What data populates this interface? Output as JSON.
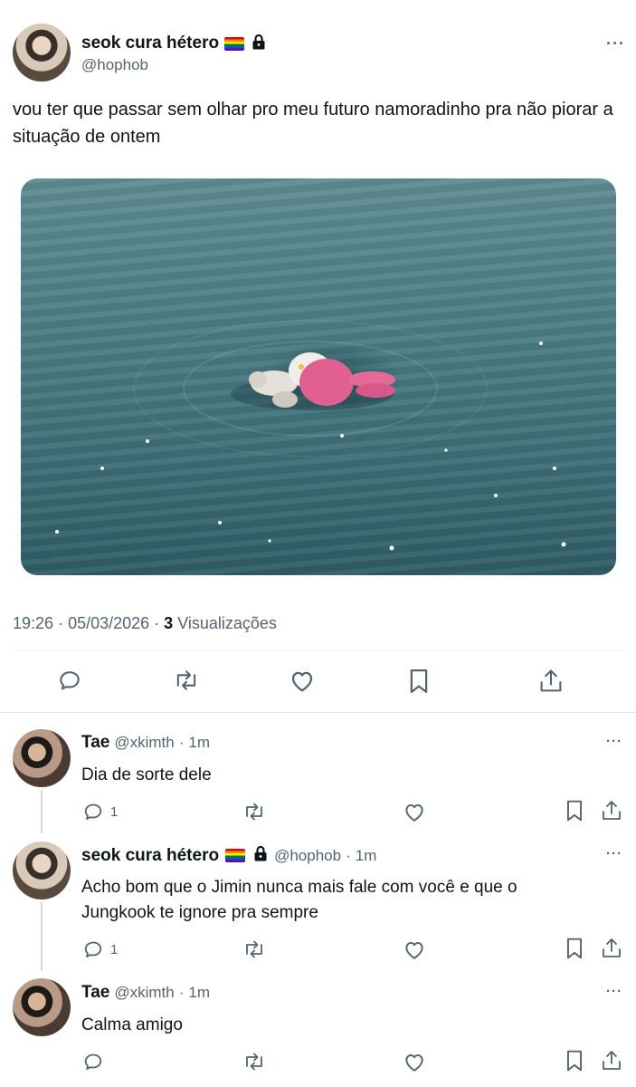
{
  "main_tweet": {
    "display_name": "seok cura hétero",
    "handle": "@hophob",
    "text": "vou ter que passar sem olhar pro meu futuro namoradinho pra não piorar a situação de ontem",
    "time": "19:26",
    "date": "05/03/2026",
    "views_count": "3",
    "views_label": "Visualizações"
  },
  "replies": [
    {
      "display_name": "Tae",
      "handle": "@xkimth",
      "age": "1m",
      "text": "Dia de sorte dele",
      "reply_count": "1"
    },
    {
      "display_name": "seok cura hétero",
      "handle": "@hophob",
      "age": "1m",
      "text": "Acho bom que o Jimin nunca mais fale com você e que o Jungkook te ignore pra sempre",
      "reply_count": "1"
    },
    {
      "display_name": "Tae",
      "handle": "@xkimth",
      "age": "1m",
      "text": "Calma amigo",
      "reply_count": ""
    }
  ],
  "colors": {
    "text": "#0f1419",
    "secondary": "#536471",
    "divider": "#eff3f4",
    "thread_line": "#cfd9de"
  },
  "icons": [
    "more-icon",
    "lock-icon",
    "rainbow-flag-icon",
    "reply-icon",
    "retweet-icon",
    "like-icon",
    "bookmark-icon",
    "share-icon"
  ]
}
